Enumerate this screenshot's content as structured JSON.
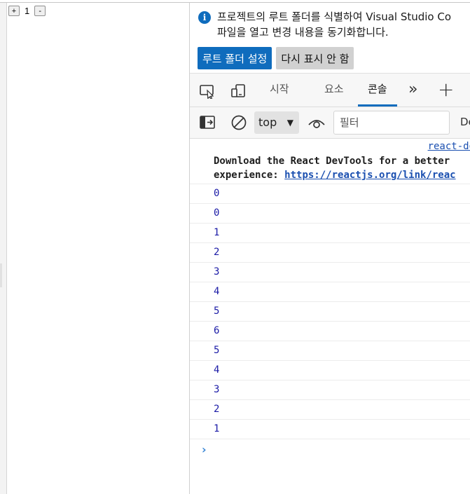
{
  "page": {
    "decrement_label": "+",
    "count": "1",
    "increment_label": "-"
  },
  "infobar": {
    "line1": "프로젝트의 루트 폴더를 식별하여 Visual Studio Co",
    "line2": "파일을 열고 변경 내용을 동기화합니다.",
    "primary_button": "루트 폴더 설정",
    "secondary_button": "다시 표시 안 함",
    "icon": "info-icon"
  },
  "tabs": [
    {
      "label": "시작"
    },
    {
      "label": "요소"
    },
    {
      "label": "콘솔",
      "active": true
    }
  ],
  "toolbar": {
    "context": "top",
    "filter_placeholder": "필터",
    "levels_label": "De"
  },
  "console": {
    "source_link": "react-do",
    "react_line1": "Download the React DevTools for a better",
    "react_line2_prefix": "experience: ",
    "react_link": "https://reactjs.org/link/reac",
    "logs": [
      "0",
      "0",
      "1",
      "2",
      "3",
      "4",
      "5",
      "6",
      "5",
      "4",
      "3",
      "2",
      "1"
    ]
  },
  "colors": {
    "accent": "#0f6cbd",
    "log_number": "#1a1aa6",
    "link": "#1a4fb0"
  }
}
